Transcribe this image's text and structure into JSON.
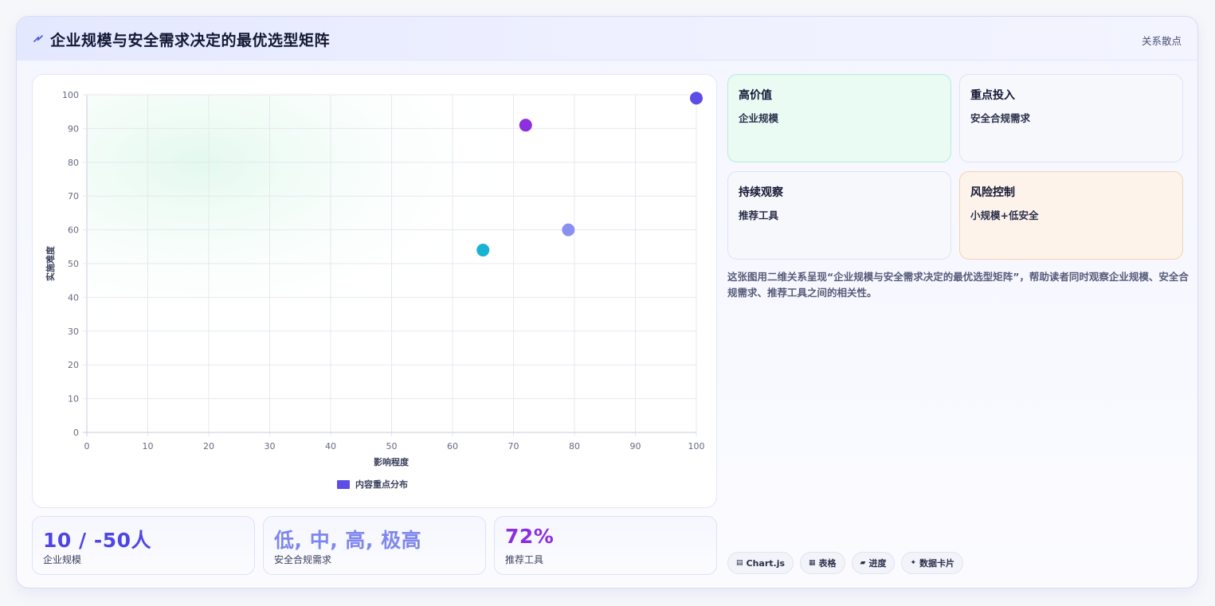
{
  "header": {
    "title": "企业规模与安全需求决定的最优选型矩阵",
    "tag": "关系散点"
  },
  "chart_data": {
    "type": "scatter",
    "xlabel": "影响程度",
    "ylabel": "实施难度",
    "xlim": [
      0,
      100
    ],
    "ylim": [
      0,
      100
    ],
    "x_ticks": [
      0,
      10,
      20,
      30,
      40,
      50,
      60,
      70,
      80,
      90,
      100
    ],
    "y_ticks": [
      0,
      10,
      20,
      30,
      40,
      50,
      60,
      70,
      80,
      90,
      100
    ],
    "grid": true,
    "legend_position": "bottom",
    "series": [
      {
        "name": "内容重点分布",
        "color": "#5b4de6",
        "points": [
          {
            "x": 72,
            "y": 91,
            "color": "#8b2fe0"
          },
          {
            "x": 79,
            "y": 60,
            "color": "#8b8ff0"
          },
          {
            "x": 65,
            "y": 54,
            "color": "#16b4d2"
          },
          {
            "x": 100,
            "y": 99,
            "color": "#5b4de6"
          }
        ]
      }
    ]
  },
  "kpis": [
    {
      "value": "10 / -50人",
      "label": "企业规模",
      "color": "#4f46e5"
    },
    {
      "value": "低, 中, 高, 极高",
      "label": "安全合规需求",
      "color": "#7f87ee"
    },
    {
      "value": "72%",
      "label": "推荐工具",
      "color": "#8b2fe0"
    }
  ],
  "quadrants": [
    {
      "title": "高价值",
      "subtitle": "企业规模"
    },
    {
      "title": "重点投入",
      "subtitle": "安全合规需求"
    },
    {
      "title": "持续观察",
      "subtitle": "推荐工具"
    },
    {
      "title": "风险控制",
      "subtitle": "小规模+低安全"
    }
  ],
  "description": "这张图用二维关系呈现“企业规模与安全需求决定的最优选型矩阵”，帮助读者同时观察企业规模、安全合规需求、推荐工具之间的相关性。",
  "chips": [
    {
      "icon": "▤",
      "label": "Chart.js"
    },
    {
      "icon": "▦",
      "label": "表格"
    },
    {
      "icon": "▰",
      "label": "进度"
    },
    {
      "icon": "✦",
      "label": "数据卡片"
    }
  ]
}
